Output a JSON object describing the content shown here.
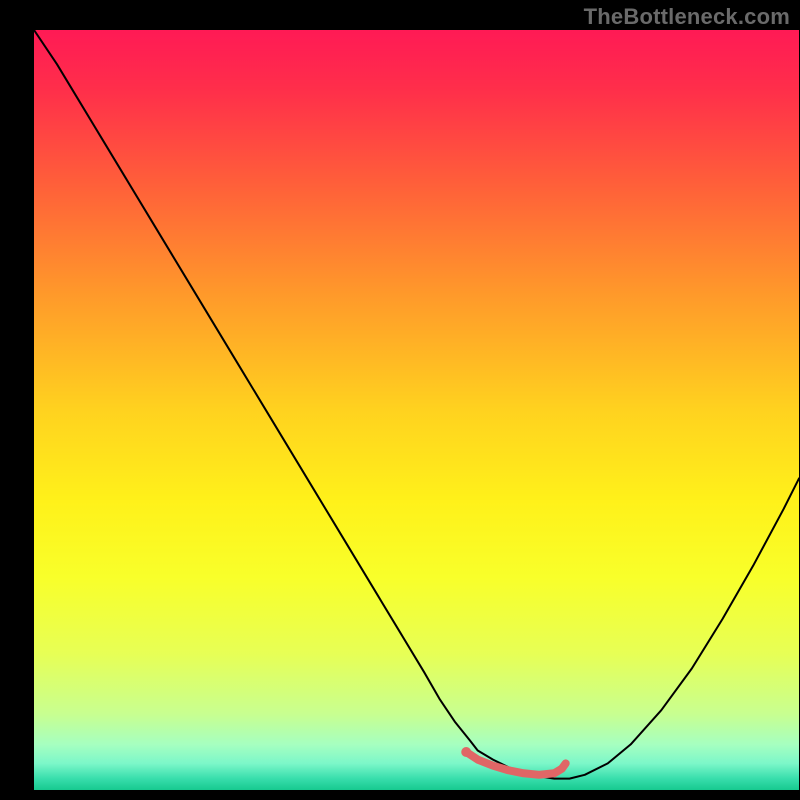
{
  "watermark": "TheBottleneck.com",
  "chart_data": {
    "type": "line",
    "title": "",
    "xlabel": "",
    "ylabel": "",
    "xlim": [
      0,
      100
    ],
    "ylim": [
      0,
      100
    ],
    "background_gradient": {
      "stops": [
        {
          "offset": 0.0,
          "color": "#ff1a55"
        },
        {
          "offset": 0.08,
          "color": "#ff2f4a"
        },
        {
          "offset": 0.2,
          "color": "#ff5e3a"
        },
        {
          "offset": 0.35,
          "color": "#ff9a2a"
        },
        {
          "offset": 0.5,
          "color": "#ffd21f"
        },
        {
          "offset": 0.62,
          "color": "#fff11a"
        },
        {
          "offset": 0.72,
          "color": "#f8ff2a"
        },
        {
          "offset": 0.82,
          "color": "#e7ff55"
        },
        {
          "offset": 0.9,
          "color": "#c8ff90"
        },
        {
          "offset": 0.94,
          "color": "#a6ffc0"
        },
        {
          "offset": 0.965,
          "color": "#7cf7c9"
        },
        {
          "offset": 0.985,
          "color": "#38deac"
        },
        {
          "offset": 1.0,
          "color": "#17c98f"
        }
      ]
    },
    "series": [
      {
        "name": "curve",
        "color": "#000000",
        "stroke_width": 2,
        "x": [
          0,
          3,
          6,
          9,
          12,
          15,
          18,
          21,
          24,
          27,
          30,
          33,
          36,
          39,
          42,
          45,
          48,
          51,
          53,
          55,
          57,
          58,
          60,
          62,
          64,
          66,
          68,
          70,
          72,
          75,
          78,
          82,
          86,
          90,
          94,
          98,
          100
        ],
        "y": [
          100,
          95.5,
          90.5,
          85.5,
          80.5,
          75.5,
          70.5,
          65.5,
          60.5,
          55.5,
          50.5,
          45.5,
          40.5,
          35.5,
          30.5,
          25.5,
          20.5,
          15.5,
          12.0,
          9.0,
          6.5,
          5.2,
          4.0,
          3.0,
          2.3,
          1.8,
          1.5,
          1.5,
          2.0,
          3.5,
          6.0,
          10.5,
          16.0,
          22.5,
          29.5,
          37.0,
          41.0
        ]
      },
      {
        "name": "marker-segment",
        "color": "#e06666",
        "stroke_width": 8,
        "x": [
          56.5,
          58,
          60,
          62,
          64,
          66,
          68,
          69,
          69.5
        ],
        "y": [
          5.0,
          4.0,
          3.2,
          2.6,
          2.2,
          2.0,
          2.2,
          2.8,
          3.5
        ]
      }
    ],
    "points": [
      {
        "name": "marker-dot",
        "x": 56.5,
        "y": 5.0,
        "r": 5,
        "color": "#e06666"
      }
    ]
  }
}
